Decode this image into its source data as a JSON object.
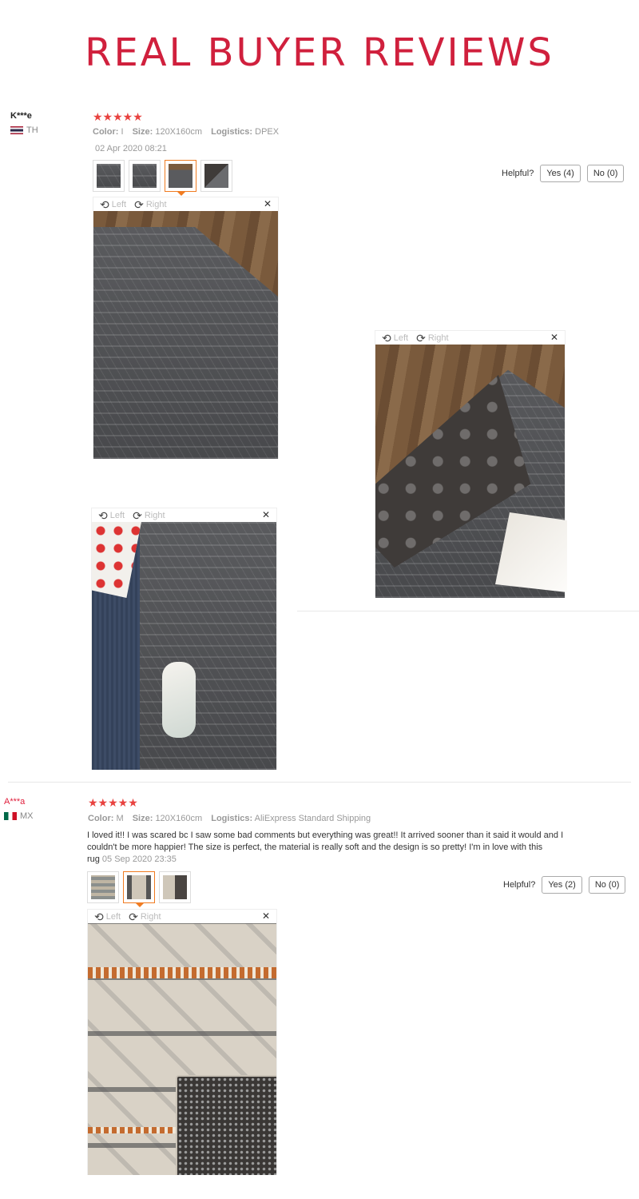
{
  "page_title": "REAL BUYER REVIEWS",
  "colors": {
    "accent": "#d0203d",
    "stars": "#e8423f",
    "active_thumb": "#f07c22"
  },
  "viewer_labels": {
    "left": "Left",
    "right": "Right",
    "close": "✕"
  },
  "reviews": [
    {
      "user": "K***e",
      "country": "TH",
      "stars": "★★★★★",
      "color_label": "Color:",
      "color_value": "I",
      "size_label": "Size:",
      "size_value": "120X160cm",
      "logistics_label": "Logistics:",
      "logistics_value": "DPEX",
      "date": "02 Apr 2020 08:21",
      "helpful_label": "Helpful?",
      "yes": "Yes (4)",
      "no": "No (0)"
    },
    {
      "user": "A***a",
      "country": "MX",
      "stars": "★★★★★",
      "color_label": "Color:",
      "color_value": "M",
      "size_label": "Size:",
      "size_value": "120X160cm",
      "logistics_label": "Logistics:",
      "logistics_value": "AliExpress Standard Shipping",
      "text": "I loved it!! I was scared bc I saw some bad comments but everything was great!! It arrived sooner than it said it would and I couldn't be more happier! The size is perfect, the material is really soft and the design is so pretty! I'm in love with this rug",
      "date": "05 Sep 2020 23:35",
      "helpful_label": "Helpful?",
      "yes": "Yes (2)",
      "no": "No (0)"
    }
  ]
}
